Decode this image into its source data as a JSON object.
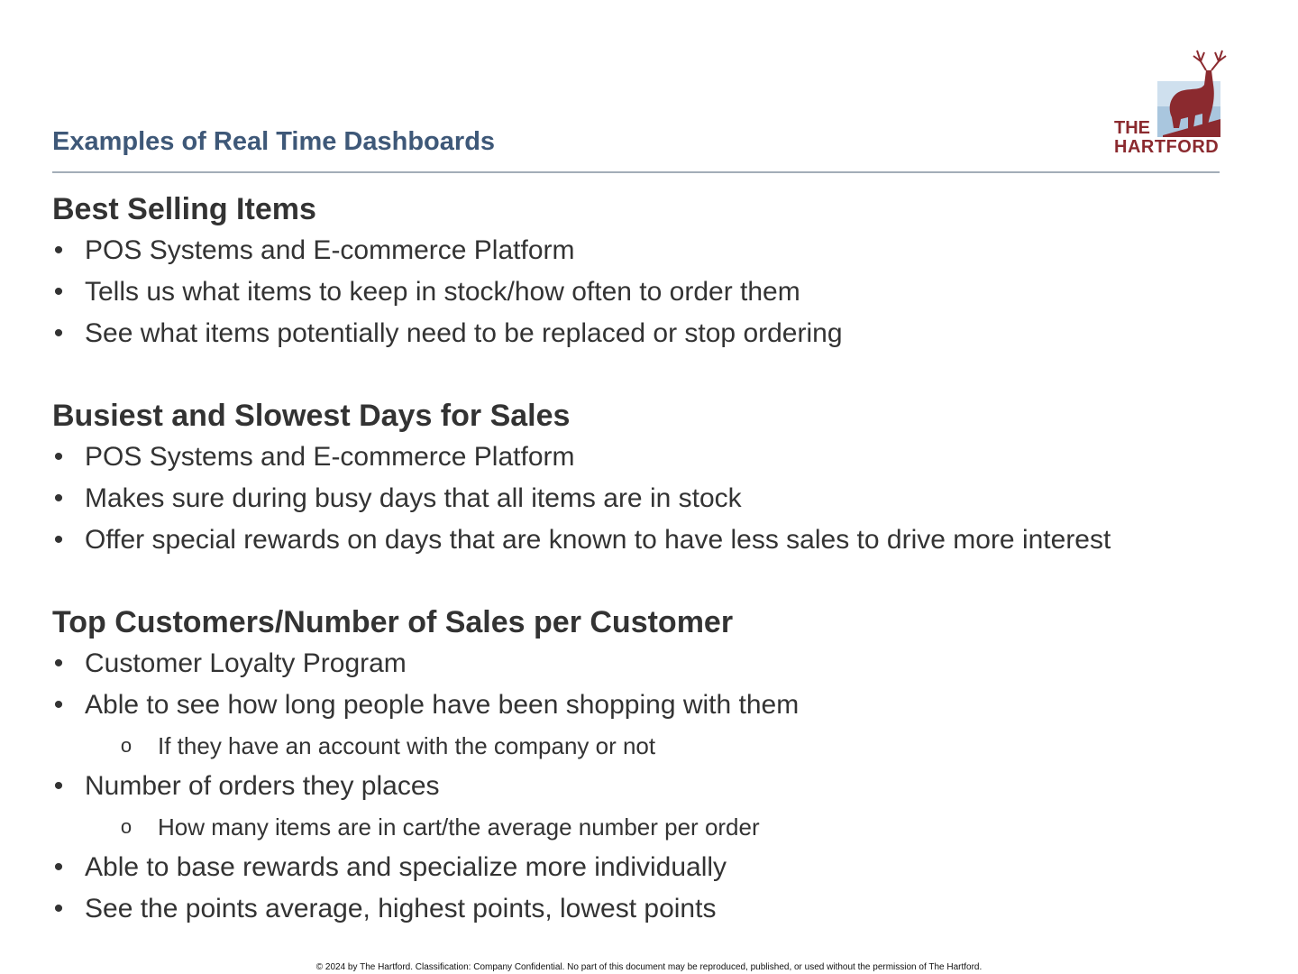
{
  "header": {
    "title": "Examples of Real Time Dashboards"
  },
  "logo": {
    "line1": "THE",
    "line2": "HARTFORD",
    "color": "#8b2a2f"
  },
  "sections": [
    {
      "heading": "Best Selling Items",
      "items": [
        {
          "level": 1,
          "text": "POS Systems and E-commerce Platform"
        },
        {
          "level": 1,
          "text": "Tells us what items to keep in stock/how often to order them"
        },
        {
          "level": 1,
          "text": "See what items potentially need to be replaced or stop ordering"
        }
      ]
    },
    {
      "heading": "Busiest and Slowest Days for Sales",
      "items": [
        {
          "level": 1,
          "text": "POS Systems and E-commerce Platform"
        },
        {
          "level": 1,
          "text": "Makes sure during busy days that all items are in stock"
        },
        {
          "level": 1,
          "text": "Offer special rewards on days that are known to have less sales to drive more interest"
        }
      ]
    },
    {
      "heading": "Top Customers/Number of Sales per Customer",
      "items": [
        {
          "level": 1,
          "text": "Customer Loyalty Program"
        },
        {
          "level": 1,
          "text": "Able to see how long people have been shopping with them"
        },
        {
          "level": 2,
          "text": "If they have an account with the company or not"
        },
        {
          "level": 1,
          "text": "Number of orders they places"
        },
        {
          "level": 2,
          "text": "How many items are in cart/the average number per order"
        },
        {
          "level": 1,
          "text": "Able to base rewards and specialize more individually"
        },
        {
          "level": 1,
          "text": "See the points average, highest points, lowest points"
        }
      ]
    }
  ],
  "bullets": {
    "level1": "•",
    "level2": "o"
  },
  "footer": {
    "text": "© 2024 by The Hartford. Classification: Company Confidential. No part of this document may be reproduced, published, or used without the permission of The Hartford."
  }
}
